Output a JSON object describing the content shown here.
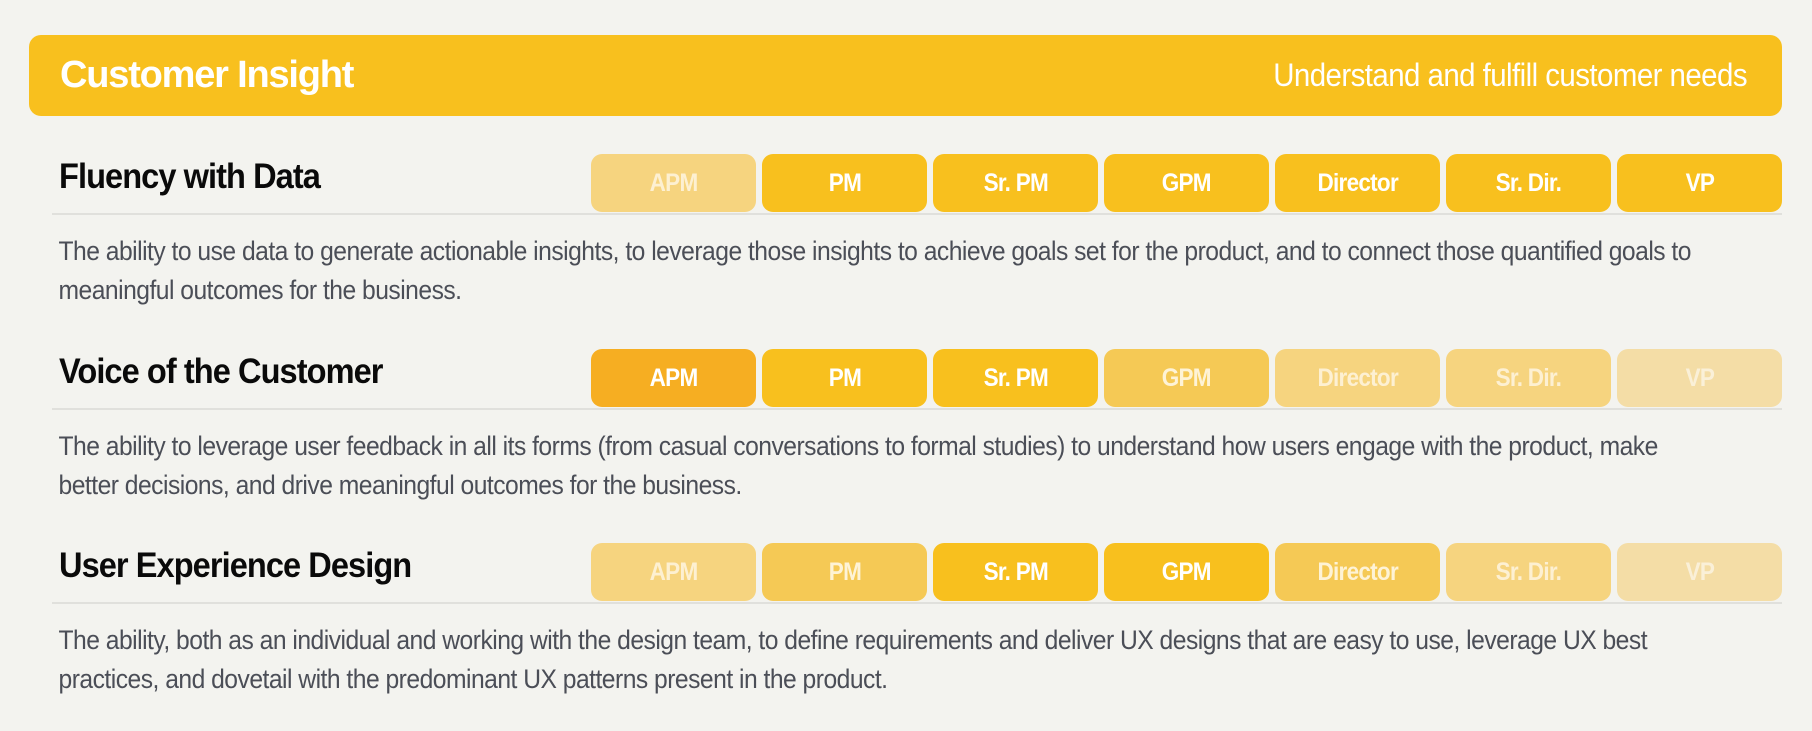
{
  "banner": {
    "title": "Customer Insight",
    "subtitle": "Understand and fulfill customer needs",
    "color": "#F8C01E"
  },
  "level_styles": {
    "emphasis": {
      "background": "#F6AE22",
      "text": "#FFFFFF"
    },
    "full": {
      "background": "#F8C01E",
      "text": "#FFFFFF"
    },
    "medium": {
      "background": "#F5C955",
      "text": "#FEF3D6"
    },
    "light": {
      "background": "#F6D47F",
      "text": "#FDF0D2"
    },
    "faint": {
      "background": "#F4DDA6",
      "text": "#FAF0D8"
    }
  },
  "skills": [
    {
      "name": "Fluency with Data",
      "description": "The ability to use data to generate actionable insights, to leverage those insights to achieve goals set for the product, and to connect those quantified goals to meaningful outcomes for the business.",
      "levels": [
        {
          "label": "APM",
          "state": "light"
        },
        {
          "label": "PM",
          "state": "full"
        },
        {
          "label": "Sr. PM",
          "state": "full"
        },
        {
          "label": "GPM",
          "state": "full"
        },
        {
          "label": "Director",
          "state": "full"
        },
        {
          "label": "Sr. Dir.",
          "state": "full"
        },
        {
          "label": "VP",
          "state": "full"
        }
      ]
    },
    {
      "name": "Voice of the Customer",
      "description": "The ability to leverage user feedback in all its forms (from casual conversations to formal studies) to understand how users engage with the product, make better decisions, and drive meaningful outcomes for the business.",
      "levels": [
        {
          "label": "APM",
          "state": "emphasis"
        },
        {
          "label": "PM",
          "state": "full"
        },
        {
          "label": "Sr. PM",
          "state": "full"
        },
        {
          "label": "GPM",
          "state": "medium"
        },
        {
          "label": "Director",
          "state": "light"
        },
        {
          "label": "Sr. Dir.",
          "state": "light"
        },
        {
          "label": "VP",
          "state": "faint"
        }
      ]
    },
    {
      "name": "User Experience Design",
      "description": "The ability, both as an individual and working with the design team, to define requirements and deliver UX designs that are easy to use, leverage UX best practices, and dovetail with the predominant UX patterns present in the product.",
      "levels": [
        {
          "label": "APM",
          "state": "light"
        },
        {
          "label": "PM",
          "state": "medium"
        },
        {
          "label": "Sr. PM",
          "state": "full"
        },
        {
          "label": "GPM",
          "state": "full"
        },
        {
          "label": "Director",
          "state": "medium"
        },
        {
          "label": "Sr. Dir.",
          "state": "light"
        },
        {
          "label": "VP",
          "state": "faint"
        }
      ]
    }
  ]
}
